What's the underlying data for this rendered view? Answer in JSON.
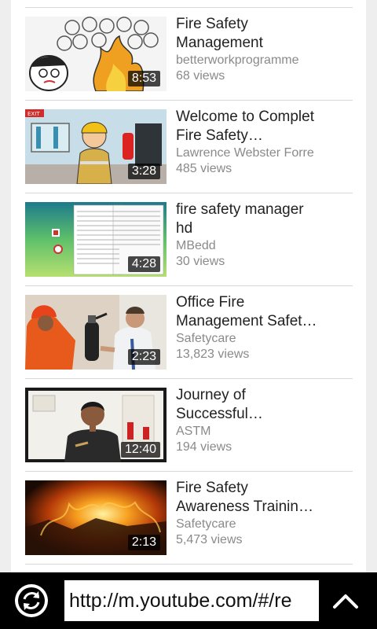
{
  "videos": [
    {
      "title_line1": "Fire Safety",
      "title_line2": "Management",
      "channel": "betterworkprogramme",
      "views": "68 views",
      "duration": "8:53",
      "thumb_icon": "cartoon-fire-thumbnail"
    },
    {
      "title_line1": "Welcome to Complet",
      "title_line2": "Fire Safety…",
      "channel": "Lawrence Webster Forre",
      "views": "485 views",
      "duration": "3:28",
      "thumb_icon": "cartoon-firefighter-thumbnail"
    },
    {
      "title_line1": "fire safety manager",
      "title_line2": "hd",
      "channel": "MBedd",
      "views": "30 views",
      "duration": "4:28",
      "thumb_icon": "document-thumbnail"
    },
    {
      "title_line1": "Office Fire",
      "title_line2": "Management Safet…",
      "channel": "Safetycare",
      "views": "13,823 views",
      "duration": "2:23",
      "thumb_icon": "extinguisher-thumbnail"
    },
    {
      "title_line1": "Journey of",
      "title_line2": "Successful…",
      "channel": "ASTM",
      "views": "194 views",
      "duration": "12:40",
      "thumb_icon": "presenter-thumbnail"
    },
    {
      "title_line1": "Fire Safety",
      "title_line2": "Awareness Trainin…",
      "channel": "Safetycare",
      "views": "5,473 views",
      "duration": "2:13",
      "thumb_icon": "fire-blaze-thumbnail"
    }
  ],
  "toolbar": {
    "url": "http://m.youtube.com/#/re",
    "reload_icon": "reload-icon",
    "scroll_top_icon": "chevron-up-icon"
  },
  "colors": {
    "toolbar_bg": "#000000",
    "title_text": "#222222",
    "secondary_text": "#8a8a8a"
  }
}
